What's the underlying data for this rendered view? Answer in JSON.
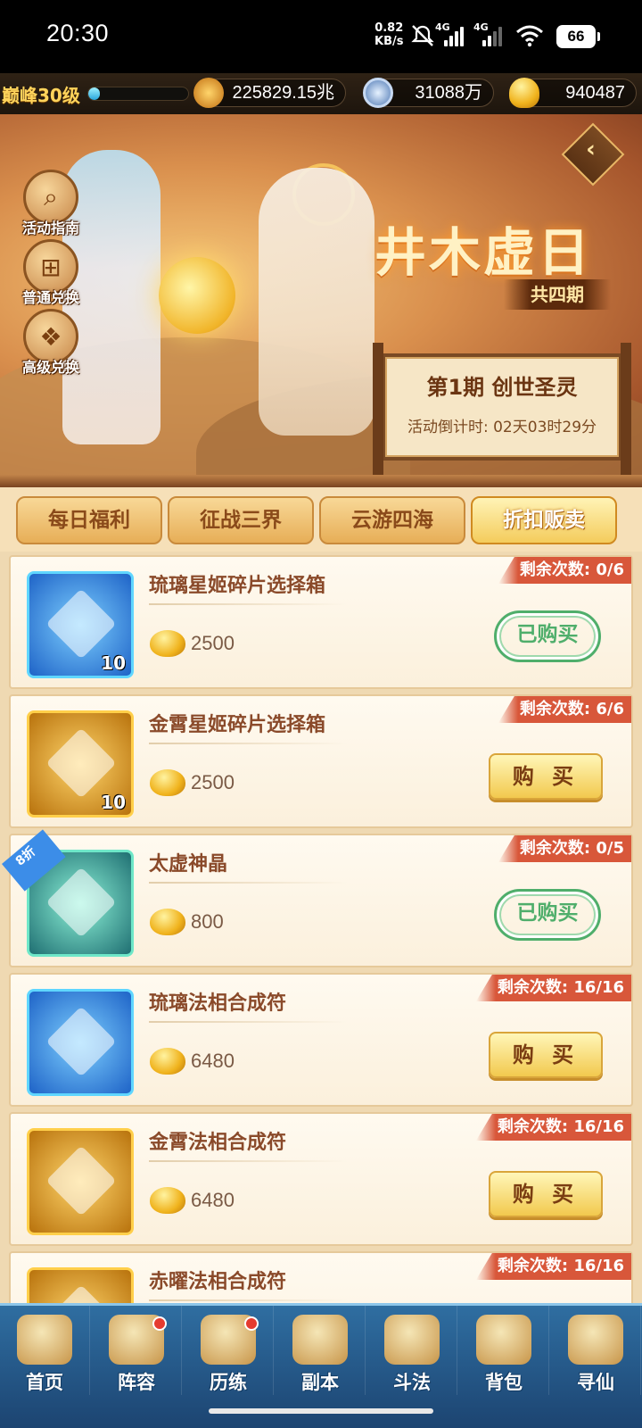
{
  "status": {
    "time": "20:30",
    "net_speed": "0.82",
    "net_unit": "KB/s",
    "sig1": "4G",
    "sig2": "4G",
    "battery": "66"
  },
  "resources": {
    "level": "巅峰30级",
    "level_progress": 0.12,
    "power": "225829.15兆",
    "coins": "31088万",
    "ingots": "940487"
  },
  "banner": {
    "title": "井木虚日",
    "periods": "共四期",
    "phase": "第1期  创世圣灵",
    "countdown": "活动倒计时: 02天03时29分",
    "side_buttons": [
      "活动指南",
      "普通兑换",
      "高级兑换"
    ]
  },
  "tabs": [
    "每日福利",
    "征战三界",
    "云游四海",
    "折扣贩卖"
  ],
  "active_tab": 3,
  "items": [
    {
      "name": "琉璃星姬碎片选择箱",
      "price": "2500",
      "remain": "剩余次数: 0/6",
      "action": "已购买",
      "qty": "10",
      "style": "blue",
      "discount": ""
    },
    {
      "name": "金霄星姬碎片选择箱",
      "price": "2500",
      "remain": "剩余次数: 6/6",
      "action": "购 买",
      "qty": "10",
      "style": "gold",
      "discount": ""
    },
    {
      "name": "太虚神晶",
      "price": "800",
      "remain": "剩余次数: 0/5",
      "action": "已购买",
      "qty": "",
      "style": "teal",
      "discount": "8折"
    },
    {
      "name": "琉璃法相合成符",
      "price": "6480",
      "remain": "剩余次数: 16/16",
      "action": "购 买",
      "qty": "",
      "style": "blue",
      "discount": ""
    },
    {
      "name": "金霄法相合成符",
      "price": "6480",
      "remain": "剩余次数: 16/16",
      "action": "购 买",
      "qty": "",
      "style": "gold",
      "discount": ""
    },
    {
      "name": "赤曜法相合成符",
      "price": "",
      "remain": "剩余次数: 16/16",
      "action": "",
      "qty": "",
      "style": "gold",
      "discount": ""
    }
  ],
  "nav": [
    "首页",
    "阵容",
    "历练",
    "副本",
    "斗法",
    "背包",
    "寻仙"
  ],
  "colors": {
    "remain_tag": "#d8573a",
    "bought": "#4fae6b",
    "buy_button": "#f2c94e",
    "nav_bg": "#2f6ea1"
  }
}
